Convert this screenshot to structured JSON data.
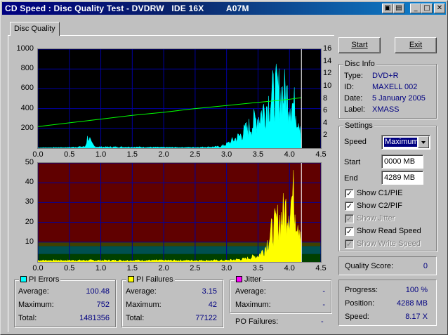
{
  "window": {
    "title": "CD Speed : Disc Quality Test - DVDRW   IDE 16X         A07M",
    "buttons": [
      "▣",
      "▤",
      "_",
      "□",
      "✕"
    ]
  },
  "tab": {
    "label": "Disc Quality"
  },
  "buttons": {
    "start": "Start",
    "exit": "Exit"
  },
  "disc_info": {
    "title": "Disc Info",
    "rows": [
      {
        "label": "Type:",
        "value": "DVD+R"
      },
      {
        "label": "ID:",
        "value": "MAXELL 002"
      },
      {
        "label": "Date:",
        "value": "5 January 2005"
      },
      {
        "label": "Label:",
        "value": "XMASS"
      }
    ]
  },
  "settings": {
    "title": "Settings",
    "speed_label": "Speed",
    "speed_value": "Maximum",
    "start_label": "Start",
    "start_value": "0000 MB",
    "end_label": "End",
    "end_value": "4289 MB",
    "checkboxes": [
      {
        "label": "Show C1/PIE",
        "checked": true,
        "enabled": true
      },
      {
        "label": "Show C2/PIF",
        "checked": true,
        "enabled": true
      },
      {
        "label": "Show Jitter",
        "checked": true,
        "enabled": false
      },
      {
        "label": "Show Read Speed",
        "checked": true,
        "enabled": true
      },
      {
        "label": "Show Write Speed",
        "checked": true,
        "enabled": false
      }
    ]
  },
  "quality": {
    "label": "Quality Score:",
    "value": "0"
  },
  "progress": {
    "rows": [
      {
        "label": "Progress:",
        "value": "100 %"
      },
      {
        "label": "Position:",
        "value": "4288 MB"
      },
      {
        "label": "Speed:",
        "value": "8.17 X"
      }
    ]
  },
  "pi_errors": {
    "title": "PI Errors",
    "color": "#00ffff",
    "rows": [
      {
        "label": "Average:",
        "value": "100.48"
      },
      {
        "label": "Maximum:",
        "value": "752"
      },
      {
        "label": "Total:",
        "value": "1481356"
      }
    ]
  },
  "pi_failures": {
    "title": "PI Failures",
    "color": "#ffff00",
    "rows": [
      {
        "label": "Average:",
        "value": "3.15"
      },
      {
        "label": "Maximum:",
        "value": "42"
      },
      {
        "label": "Total:",
        "value": "77122"
      }
    ]
  },
  "jitter": {
    "title": "Jitter",
    "color": "#ff00ff",
    "rows": [
      {
        "label": "Average:",
        "value": "-"
      },
      {
        "label": "Maximum:",
        "value": "-"
      }
    ],
    "po_label": "PO Failures:",
    "po_value": "-"
  },
  "chart_data": [
    {
      "type": "area",
      "name": "pi-errors-chart",
      "ylim": [
        0,
        1000
      ],
      "y2lim": [
        0,
        16
      ],
      "xlim": [
        0,
        4.5
      ],
      "x_ticks": [
        "0.0",
        "0.5",
        "1.0",
        "1.5",
        "2.0",
        "2.5",
        "3.0",
        "3.5",
        "4.0",
        "4.5"
      ],
      "y_ticks": [
        "1000",
        "800",
        "600",
        "400",
        "200"
      ],
      "y2_ticks": [
        "16",
        "14",
        "12",
        "10",
        "8",
        "6",
        "4",
        "2"
      ],
      "series": [
        {
          "name": "PI Errors",
          "color": "#00ffff",
          "x": [
            0.0,
            0.5,
            0.75,
            0.8,
            0.85,
            0.9,
            1.0,
            1.5,
            2.0,
            2.5,
            2.9,
            3.0,
            3.2,
            3.4,
            3.5,
            3.6,
            3.7,
            3.8,
            3.9,
            4.0,
            4.1,
            4.19
          ],
          "y": [
            5,
            10,
            20,
            160,
            60,
            20,
            15,
            15,
            10,
            10,
            20,
            50,
            150,
            300,
            400,
            500,
            650,
            720,
            700,
            650,
            500,
            300
          ]
        },
        {
          "name": "Read Speed",
          "color": "#00ff00",
          "axis": "right",
          "x": [
            0.0,
            0.5,
            1.0,
            1.5,
            2.0,
            2.5,
            3.0,
            3.5,
            4.0,
            4.19
          ],
          "y": [
            3.5,
            4.1,
            4.7,
            5.3,
            5.8,
            6.4,
            6.9,
            7.4,
            7.9,
            8.17
          ]
        }
      ],
      "marker_x": 4.19
    },
    {
      "type": "area",
      "name": "pi-failures-chart",
      "ylim": [
        0,
        50
      ],
      "xlim": [
        0,
        4.5
      ],
      "x_ticks": [
        "0.0",
        "0.5",
        "1.0",
        "1.5",
        "2.0",
        "2.5",
        "3.0",
        "3.5",
        "4.0",
        "4.5"
      ],
      "y_ticks": [
        "50",
        "40",
        "30",
        "20",
        "10"
      ],
      "series": [
        {
          "name": "PI Failures",
          "color": "#ffff00",
          "x": [
            0.0,
            0.5,
            1.0,
            1.5,
            2.0,
            2.5,
            3.0,
            3.3,
            3.5,
            3.6,
            3.7,
            3.8,
            3.9,
            4.0,
            4.05,
            4.1,
            4.19
          ],
          "y": [
            1,
            1,
            1,
            1,
            1,
            1,
            1,
            2,
            4,
            8,
            18,
            25,
            30,
            38,
            42,
            35,
            20
          ]
        }
      ],
      "bands": [
        {
          "from": 0,
          "to": 4,
          "color": "#004000"
        },
        {
          "from": 4,
          "to": 8,
          "color": "#005050"
        },
        {
          "from": 8,
          "to": 10,
          "color": "#404000"
        },
        {
          "from": 10,
          "to": 50,
          "color": "#600000"
        }
      ],
      "marker_x": 4.19
    }
  ]
}
